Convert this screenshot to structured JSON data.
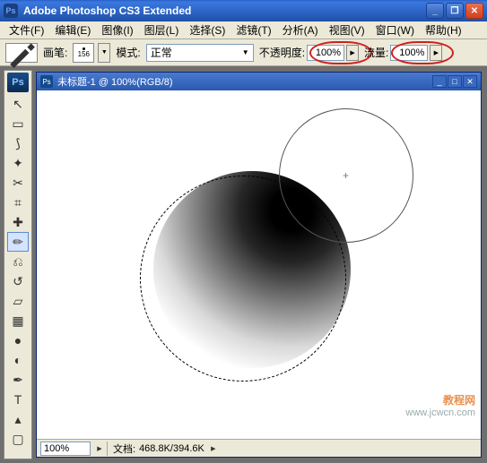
{
  "app": {
    "title": "Adobe Photoshop CS3 Extended",
    "icon_label": "Ps"
  },
  "menu": {
    "items": [
      "文件(F)",
      "编辑(E)",
      "图像(I)",
      "图层(L)",
      "选择(S)",
      "滤镜(T)",
      "分析(A)",
      "视图(V)",
      "窗口(W)",
      "帮助(H)"
    ]
  },
  "options": {
    "brush_label": "画笔:",
    "brush_size": "156",
    "mode_label": "模式:",
    "mode_value": "正常",
    "opacity_label": "不透明度:",
    "opacity_value": "100%",
    "flow_label": "流量:",
    "flow_value": "100%"
  },
  "toolbox": {
    "badge": "Ps",
    "tools": [
      {
        "name": "move-tool",
        "glyph": "↖"
      },
      {
        "name": "marquee-tool",
        "glyph": "▭"
      },
      {
        "name": "lasso-tool",
        "glyph": "⟆"
      },
      {
        "name": "magic-wand-tool",
        "glyph": "✦"
      },
      {
        "name": "crop-tool",
        "glyph": "✂"
      },
      {
        "name": "slice-tool",
        "glyph": "⌗"
      },
      {
        "name": "healing-tool",
        "glyph": "✚"
      },
      {
        "name": "brush-tool",
        "glyph": "✏",
        "active": true
      },
      {
        "name": "stamp-tool",
        "glyph": "⎌"
      },
      {
        "name": "history-brush-tool",
        "glyph": "↺"
      },
      {
        "name": "eraser-tool",
        "glyph": "▱"
      },
      {
        "name": "gradient-tool",
        "glyph": "▦"
      },
      {
        "name": "blur-tool",
        "glyph": "●"
      },
      {
        "name": "dodge-tool",
        "glyph": "◐"
      },
      {
        "name": "pen-tool",
        "glyph": "✒"
      },
      {
        "name": "type-tool",
        "glyph": "T"
      },
      {
        "name": "path-select-tool",
        "glyph": "▴"
      },
      {
        "name": "shape-tool",
        "glyph": "▢"
      }
    ]
  },
  "document": {
    "title": "未标题-1 @ 100%(RGB/8)",
    "icon_label": "Ps"
  },
  "status": {
    "zoom": "100%",
    "doc_label": "文档:",
    "doc_sizes": "468.8K/394.6K"
  },
  "watermark": {
    "line1": "教程网",
    "line2": "www.jcwcn.com"
  }
}
